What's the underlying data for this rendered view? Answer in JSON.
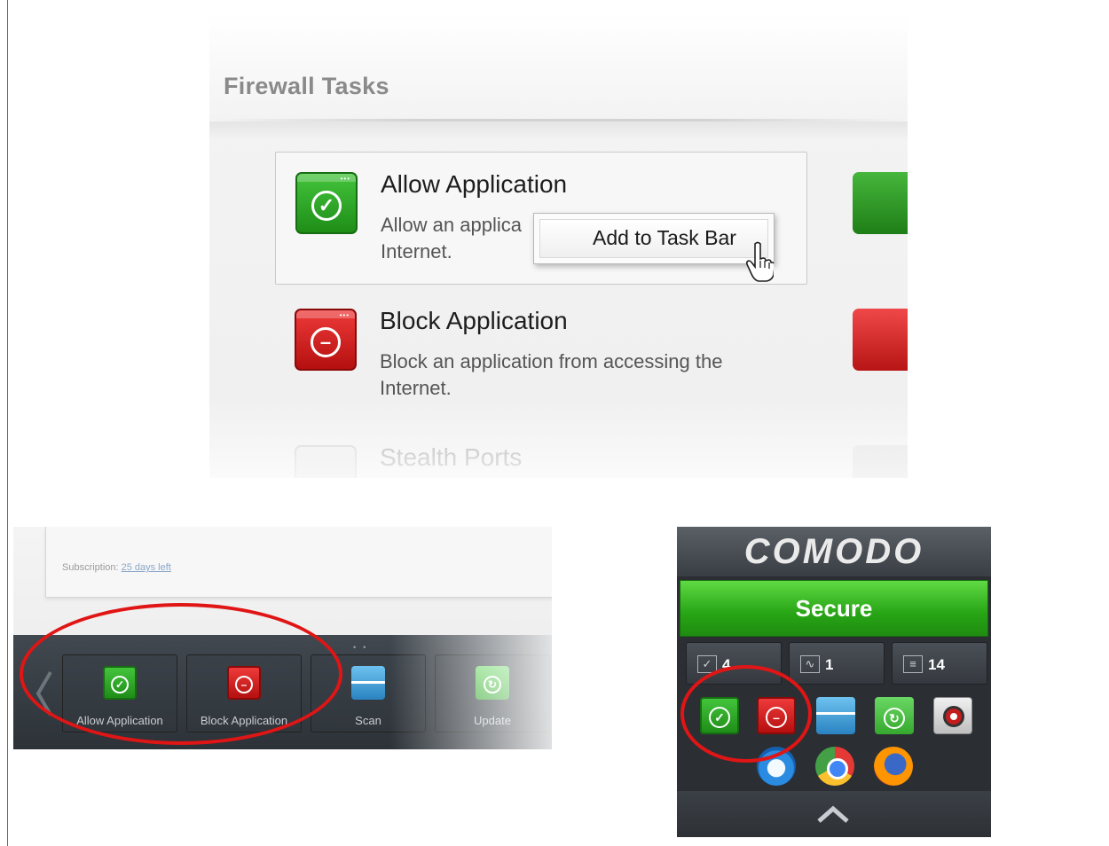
{
  "firewall_tasks": {
    "title": "Firewall Tasks",
    "items": [
      {
        "title": "Allow Application",
        "description": "Allow an application from accessing the Internet.",
        "description_visible_line1": "Allow an applica",
        "description_visible_line2": "Internet.",
        "icon": "check-circle-icon",
        "color": "#2ea326"
      },
      {
        "title": "Block Application",
        "description": "Block an application from accessing the Internet.",
        "icon": "minus-circle-icon",
        "color": "#d61b1b"
      },
      {
        "title": "Stealth Ports",
        "icon": "window-icon"
      }
    ],
    "context_menu": {
      "label": "Add to Task Bar"
    },
    "cursor": "hand-pointer-icon"
  },
  "widget_taskbar": {
    "subscription_label": "Subscription:",
    "subscription_link": "25 days left",
    "tiles": [
      {
        "label": "Allow Application",
        "icon": "check-circle-icon"
      },
      {
        "label": "Block Application",
        "icon": "minus-circle-icon"
      },
      {
        "label": "Scan",
        "icon": "scan-icon"
      },
      {
        "label": "Update",
        "icon": "update-icon"
      }
    ]
  },
  "comodo_widget": {
    "brand": "COMODO",
    "status": "Secure",
    "status_color": "#27a415",
    "counters": [
      {
        "icon": "checklist-icon",
        "value": "4"
      },
      {
        "icon": "activity-icon",
        "value": "1"
      },
      {
        "icon": "document-icon",
        "value": "14"
      }
    ],
    "apps": [
      "check-circle-icon",
      "minus-circle-icon",
      "scan-icon",
      "update-icon",
      "target-icon"
    ],
    "browsers": [
      "internet-explorer-icon",
      "chrome-icon",
      "firefox-icon"
    ]
  },
  "highlight_color": "#e01515"
}
